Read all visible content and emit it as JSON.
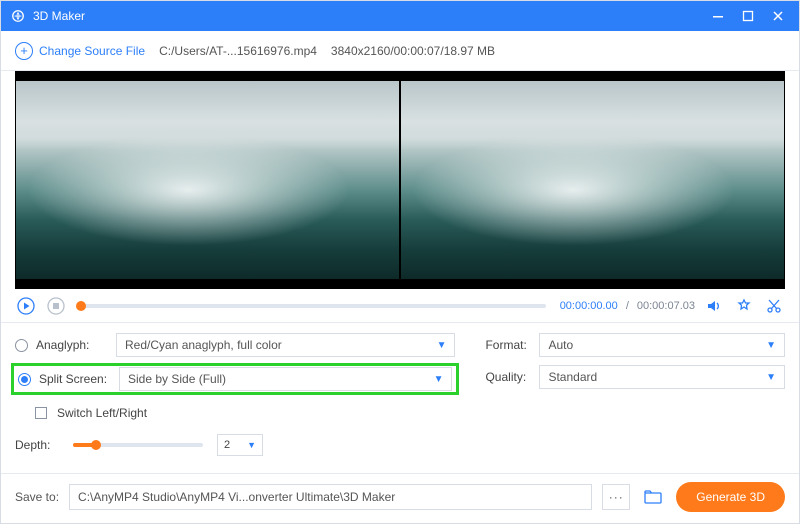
{
  "titlebar": {
    "title": "3D Maker"
  },
  "topbar": {
    "change_label": "Change Source File",
    "filepath": "C:/Users/AT-...15616976.mp4",
    "fileinfo": "3840x2160/00:00:07/18.97 MB"
  },
  "player": {
    "current": "00:00:00.00",
    "duration": "00:00:07.03"
  },
  "options": {
    "anaglyph_label": "Anaglyph:",
    "anaglyph_value": "Red/Cyan anaglyph, full color",
    "split_label": "Split Screen:",
    "split_value": "Side by Side (Full)",
    "switch_label": "Switch Left/Right",
    "depth_label": "Depth:",
    "depth_value": "2",
    "format_label": "Format:",
    "format_value": "Auto",
    "quality_label": "Quality:",
    "quality_value": "Standard"
  },
  "footer": {
    "save_label": "Save to:",
    "save_path": "C:\\AnyMP4 Studio\\AnyMP4 Vi...onverter Ultimate\\3D Maker",
    "generate_label": "Generate 3D"
  }
}
